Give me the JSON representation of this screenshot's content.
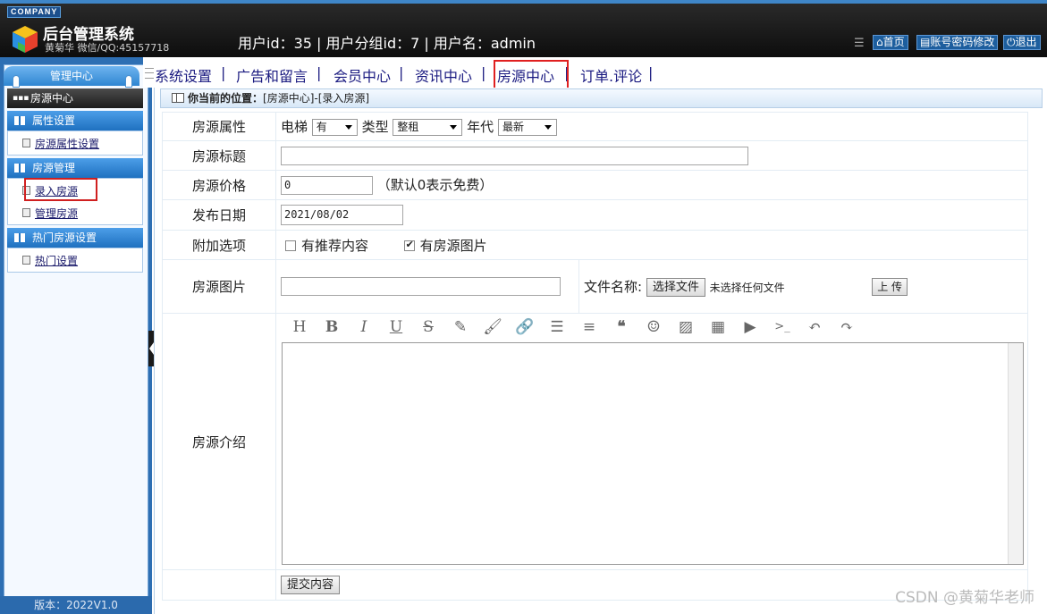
{
  "header": {
    "company": "COMPANY",
    "title": "后台管理系统",
    "subtitle": "黄菊华 微信/QQ:45157718",
    "user_info": "用户id：35 | 用户分组id：7 | 用户名：admin",
    "buttons": [
      {
        "icon": "home-icon",
        "label": "首页"
      },
      {
        "icon": "account-icon",
        "label": "账号密码修改"
      },
      {
        "icon": "power-icon",
        "label": "退出"
      }
    ]
  },
  "sidebar": {
    "title": "管理中心",
    "current": "房源中心",
    "groups": [
      {
        "title": "属性设置",
        "items": [
          "房源属性设置"
        ]
      },
      {
        "title": "房源管理",
        "items": [
          "录入房源",
          "管理房源"
        ]
      },
      {
        "title": "热门房源设置",
        "items": [
          "热门设置"
        ]
      }
    ],
    "version": "版本：2022V1.0"
  },
  "topnav": {
    "items": [
      "系统设置",
      "广告和留言",
      "会员中心",
      "资讯中心",
      "房源中心",
      "订单.评论"
    ],
    "separator": "|",
    "active": "房源中心"
  },
  "breadcrumb": {
    "label": "你当前的位置：",
    "path": "[房源中心]-[录入房源]"
  },
  "form": {
    "attr": {
      "label": "房源属性",
      "elevator_label": "电梯",
      "elevator_value": "有",
      "type_label": "类型",
      "type_value": "整租",
      "year_label": "年代",
      "year_value": "最新"
    },
    "title": {
      "label": "房源标题",
      "value": ""
    },
    "price": {
      "label": "房源价格",
      "value": "0",
      "hint": "（默认0表示免费）"
    },
    "date": {
      "label": "发布日期",
      "value": "2021/08/02"
    },
    "options": {
      "label": "附加选项",
      "items": [
        {
          "label": "有推荐内容",
          "checked": false
        },
        {
          "label": "有房源图片",
          "checked": true
        }
      ]
    },
    "image": {
      "label": "房源图片",
      "value": "",
      "file_label": "文件名称:",
      "choose_button": "选择文件",
      "no_file": "未选择任何文件",
      "upload_button": "上 传"
    },
    "intro": {
      "label": "房源介绍",
      "toolbar": [
        "heading-icon",
        "bold-icon",
        "italic-icon",
        "underline-icon",
        "strikethrough-icon",
        "highlighter-icon",
        "brush-icon",
        "link-icon",
        "bullet-list-icon",
        "align-icon",
        "quote-icon",
        "emoji-icon",
        "image-icon",
        "table-icon",
        "video-icon",
        "code-icon",
        "undo-icon",
        "redo-icon"
      ]
    },
    "submit": "提交内容"
  },
  "watermark": "CSDN @黄菊华老师",
  "colors": {
    "header_bg": "#151515",
    "sidebar_bg": "#2e6fb3",
    "highlight": "#e02020",
    "nav_text": "#1a1a80"
  }
}
